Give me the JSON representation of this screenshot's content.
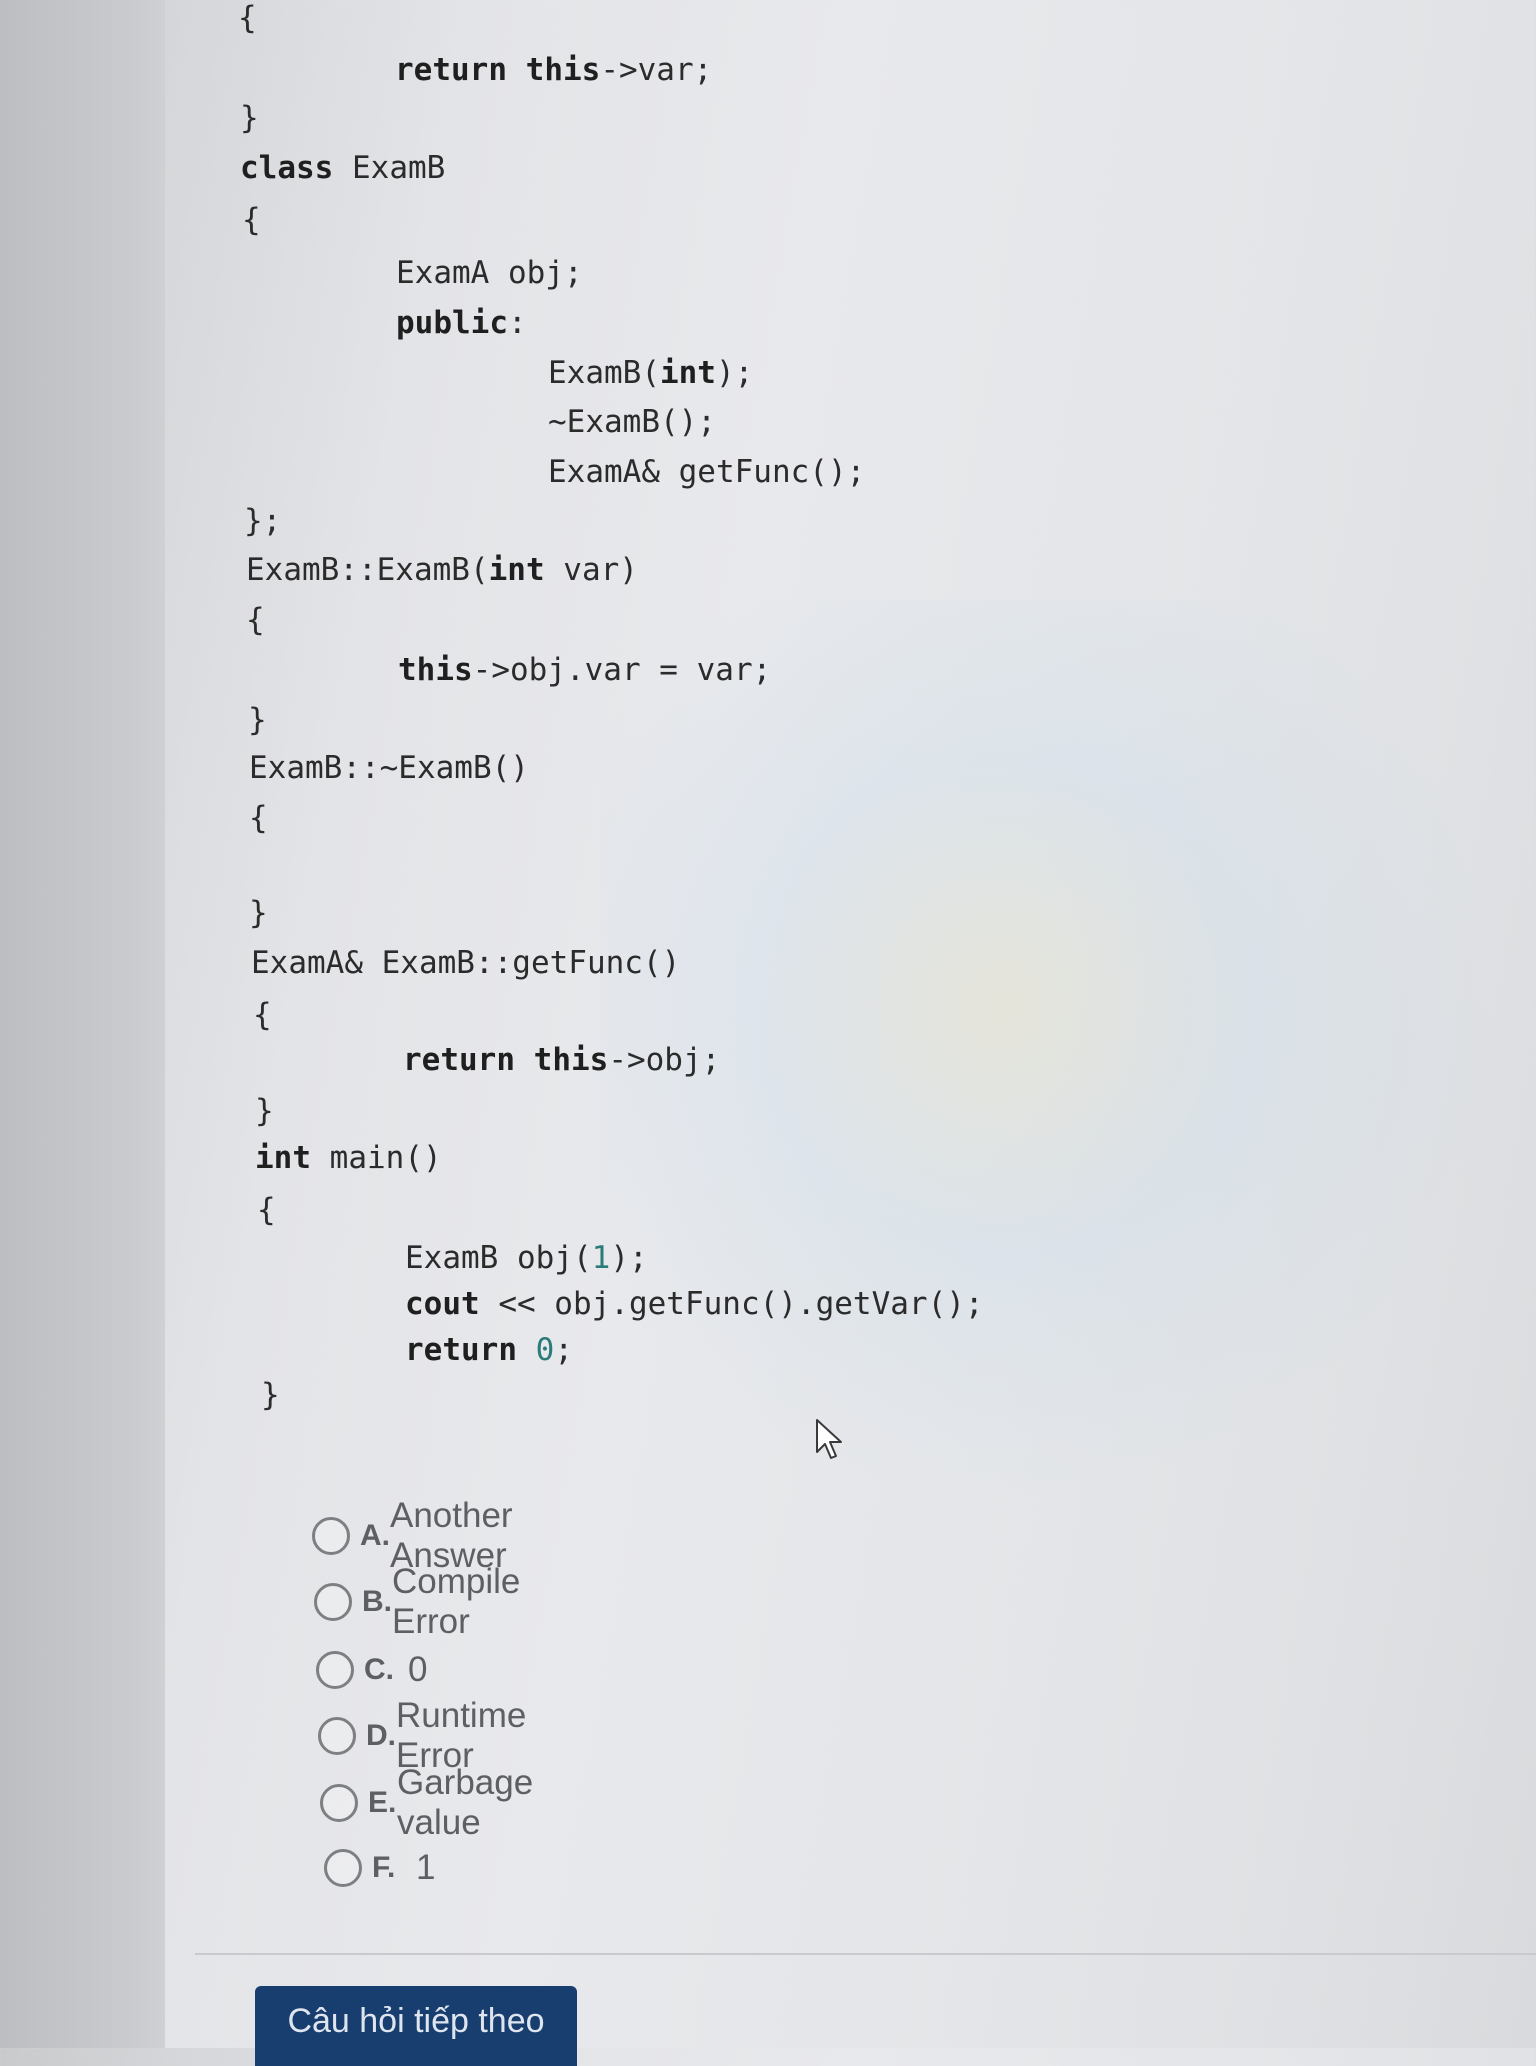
{
  "code": {
    "lines": [
      [
        {
          "t": "{"
        }
      ],
      [
        {
          "t": "return",
          "k": 1
        },
        {
          "t": " "
        },
        {
          "t": "this",
          "k": 1
        },
        {
          "t": "->var;"
        }
      ],
      [
        {
          "t": "}"
        }
      ],
      [
        {
          "t": "class",
          "k": 1
        },
        {
          "t": " ExamB"
        }
      ],
      [
        {
          "t": "{"
        }
      ],
      [
        {
          "t": "ExamA obj;"
        }
      ],
      [
        {
          "t": "public",
          "k": 1
        },
        {
          "t": ":"
        }
      ],
      [
        {
          "t": "ExamB("
        },
        {
          "t": "int",
          "k": 1
        },
        {
          "t": ");"
        }
      ],
      [
        {
          "t": "~ExamB();"
        }
      ],
      [
        {
          "t": "ExamA& getFunc();"
        }
      ],
      [
        {
          "t": "};"
        }
      ],
      [
        {
          "t": "ExamB::ExamB("
        },
        {
          "t": "int",
          "k": 1
        },
        {
          "t": " var)"
        }
      ],
      [
        {
          "t": "{"
        }
      ],
      [
        {
          "t": "this",
          "k": 1
        },
        {
          "t": "->obj.var = var;"
        }
      ],
      [
        {
          "t": "}"
        }
      ],
      [
        {
          "t": "ExamB::~ExamB()"
        }
      ],
      [
        {
          "t": "{"
        }
      ],
      [
        {
          "t": "}"
        }
      ],
      [
        {
          "t": "ExamA& ExamB::getFunc()"
        }
      ],
      [
        {
          "t": "{"
        }
      ],
      [
        {
          "t": "return",
          "k": 1
        },
        {
          "t": " "
        },
        {
          "t": "this",
          "k": 1
        },
        {
          "t": "->obj;"
        }
      ],
      [
        {
          "t": "}"
        }
      ],
      [
        {
          "t": "int",
          "k": 1
        },
        {
          "t": " main()"
        }
      ],
      [
        {
          "t": "{"
        }
      ],
      [
        {
          "t": "ExamB obj("
        },
        {
          "t": "1",
          "n": 1
        },
        {
          "t": ");"
        }
      ],
      [
        {
          "t": "cout",
          "k": 1
        },
        {
          "t": " << obj.getFunc().getVar();"
        }
      ],
      [
        {
          "t": "return",
          "k": 1
        },
        {
          "t": " "
        },
        {
          "t": "0",
          "n": 1
        },
        {
          "t": ";"
        }
      ],
      [
        {
          "t": "}"
        }
      ]
    ]
  },
  "options": [
    {
      "letter": "A.",
      "text": "Another Answer"
    },
    {
      "letter": "B.",
      "text": "Compile Error"
    },
    {
      "letter": "C.",
      "text": "0"
    },
    {
      "letter": "D.",
      "text": "Runtime Error"
    },
    {
      "letter": "E.",
      "text": "Garbage value"
    },
    {
      "letter": "F.",
      "text": "1"
    }
  ],
  "next_button": {
    "label": "Câu hỏi tiếp theo"
  }
}
